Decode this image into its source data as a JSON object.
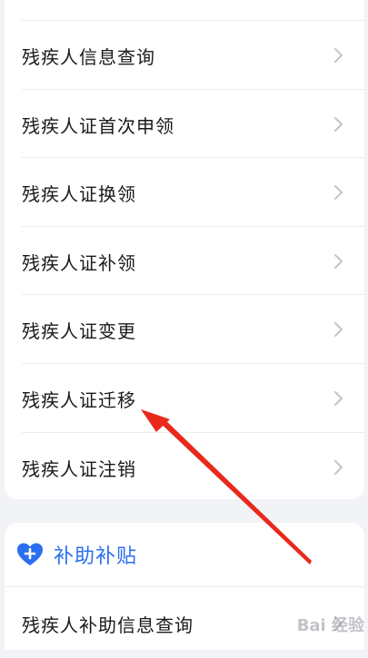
{
  "list_items": [
    {
      "label": "残疾人信息查询"
    },
    {
      "label": "残疾人证首次申领"
    },
    {
      "label": "残疾人证换领"
    },
    {
      "label": "残疾人证补领"
    },
    {
      "label": "残疾人证变更"
    },
    {
      "label": "残疾人证迁移"
    },
    {
      "label": "残疾人证注销"
    }
  ],
  "subsidy_section": {
    "title": "补助补贴",
    "icon": "heart-plus-icon",
    "items": [
      {
        "label": "残疾人补助信息查询"
      }
    ]
  },
  "icons": {
    "chevron": "chevron-right-icon"
  },
  "colors": {
    "accent": "#2a6ff0",
    "annotation_arrow": "#e8291c",
    "background": "#f2f3f7",
    "card": "#ffffff"
  },
  "watermark": "Bai 经验"
}
